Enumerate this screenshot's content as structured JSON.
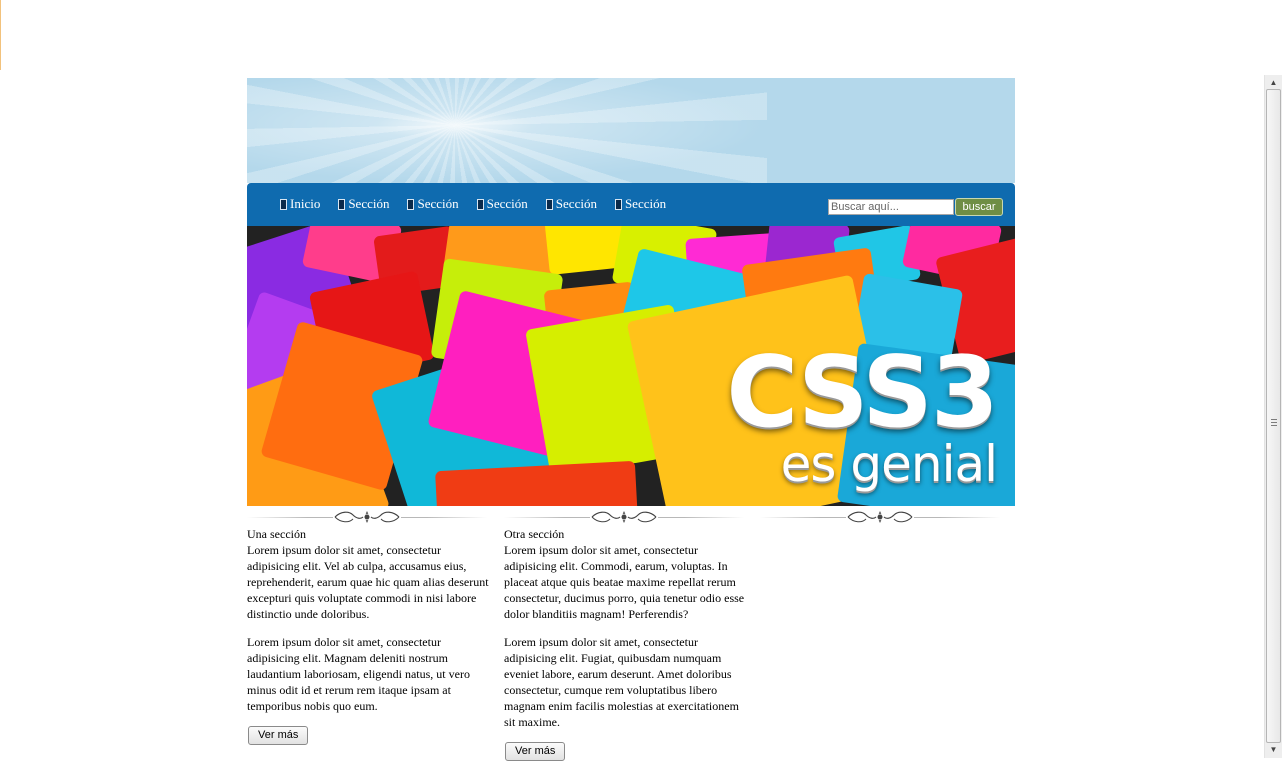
{
  "nav": {
    "items": [
      {
        "label": "Inicio"
      },
      {
        "label": "Sección"
      },
      {
        "label": "Sección"
      },
      {
        "label": "Sección"
      },
      {
        "label": "Sección"
      },
      {
        "label": "Sección"
      }
    ],
    "search_placeholder": "Buscar aquí...",
    "search_button": "buscar"
  },
  "hero": {
    "line1": "CSS3",
    "line2": "es genial"
  },
  "sections": [
    {
      "title": "Una sección",
      "paragraphs": [
        "Lorem ipsum dolor sit amet, consectetur adipisicing elit. Vel ab culpa, accusamus eius, reprehenderit, earum quae hic quam alias deserunt excepturi quis voluptate commodi in nisi labore distinctio unde doloribus.",
        "Lorem ipsum dolor sit amet, consectetur adipisicing elit. Magnam deleniti nostrum laudantium laboriosam, eligendi natus, ut vero minus odit id et rerum rem itaque ipsam at temporibus nobis quo eum."
      ],
      "button": "Ver más"
    },
    {
      "title": "Otra sección",
      "paragraphs": [
        "Lorem ipsum dolor sit amet, consectetur adipisicing elit. Commodi, earum, voluptas. In placeat atque quis beatae maxime repellat rerum consectetur, ducimus porro, quia tenetur odio esse dolor blanditiis magnam! Perferendis?",
        "Lorem ipsum dolor sit amet, consectetur adipisicing elit. Fugiat, quibusdam numquam eveniet labore, earum deserunt. Amet doloribus consectetur, cumque rem voluptatibus libero magnam enim facilis molestias at exercitationem sit maxime."
      ],
      "button": "Ver más"
    }
  ],
  "colors": {
    "header_sky": "#b4d8eb",
    "nav_blue": "#0f6baf",
    "search_button": "#6f8e45"
  },
  "icons": {
    "nav_item": "square-bullet-icon",
    "ornament": "flourish-icon"
  }
}
